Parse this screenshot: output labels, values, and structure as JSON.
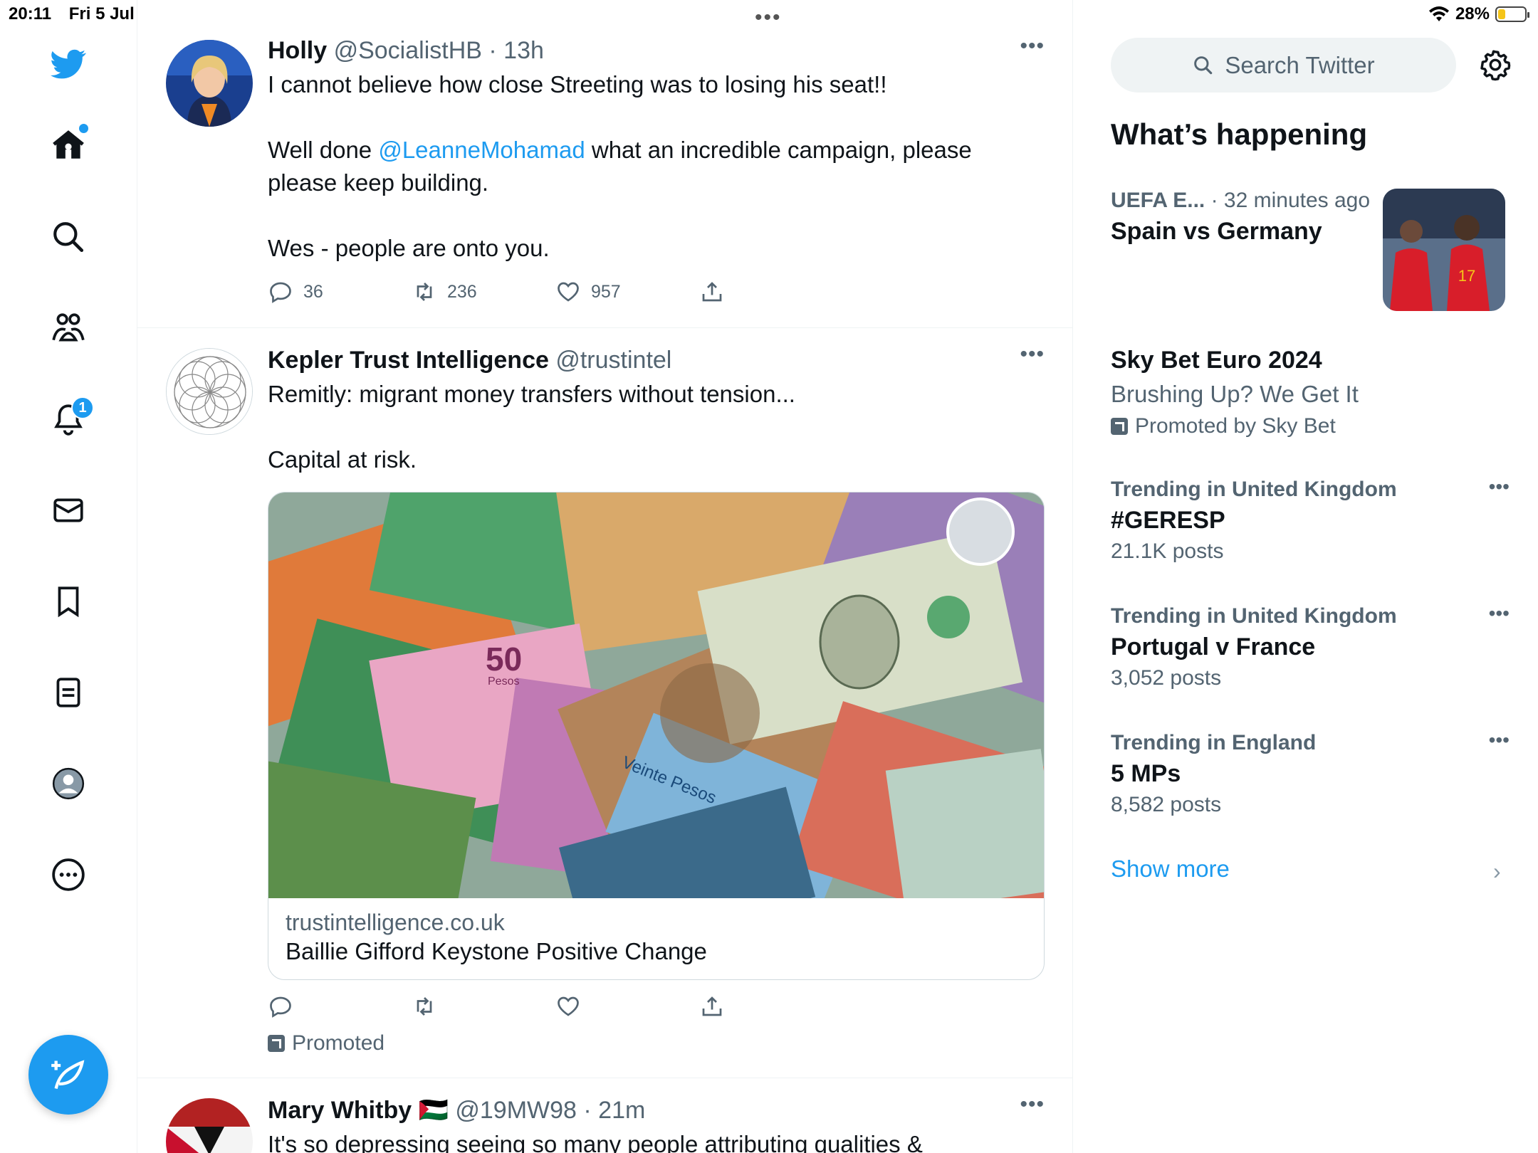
{
  "status": {
    "time": "20:11",
    "date": "Fri 5 Jul",
    "battery": "28%",
    "battery_level": 0.28
  },
  "multitask": "•••",
  "nav": {
    "notifications_badge": "1"
  },
  "tweets": [
    {
      "name": "Holly",
      "handle": "@SocialistHB",
      "time": "13h",
      "line1": "I cannot believe how close Streeting was to losing his seat!!",
      "line2_pre": "Well done ",
      "line2_mention": "@LeanneMohamad",
      "line2_post": " what an incredible campaign, please please keep building.",
      "line3": "Wes - people are onto you.",
      "replies": "36",
      "retweets": "236",
      "likes": "957"
    },
    {
      "name": "Kepler Trust Intelligence",
      "handle": "@trustintel",
      "line1": "Remitly: migrant money transfers without tension...",
      "line2": "Capital at risk.",
      "card_domain": "trustintelligence.co.uk",
      "card_title": "Baillie Gifford Keystone Positive Change",
      "card_text_50": "50",
      "card_text_pesos": "Pesos",
      "card_text_veinte": "Veinte Pesos",
      "promoted": "Promoted"
    },
    {
      "name": "Mary Whitby",
      "flag": "🇵🇸",
      "handle": "@19MW98",
      "time": "21m",
      "line1": "It's so depressing seeing so many people attributing qualities &"
    }
  ],
  "sidebar": {
    "search_placeholder": "Search Twitter",
    "section_title": "What’s happening",
    "trends": [
      {
        "context": "UEFA E...",
        "context_time": "· 32 minutes ago",
        "title": "Spain vs Germany"
      },
      {
        "title": "Sky Bet Euro 2024",
        "subtitle": "Brushing Up? We Get It",
        "promoted": "Promoted by Sky Bet"
      },
      {
        "context": "Trending in United Kingdom",
        "title": "#GERESP",
        "posts": "21.1K posts"
      },
      {
        "context": "Trending in United Kingdom",
        "title": "Portugal v France",
        "posts": "3,052 posts"
      },
      {
        "context": "Trending in England",
        "title": "5 MPs",
        "posts": "8,582 posts"
      }
    ],
    "show_more": "Show more"
  },
  "colors": {
    "accent": "#1d9bf0",
    "text": "#0f1419",
    "muted": "#536471",
    "border": "#eff3f4"
  }
}
